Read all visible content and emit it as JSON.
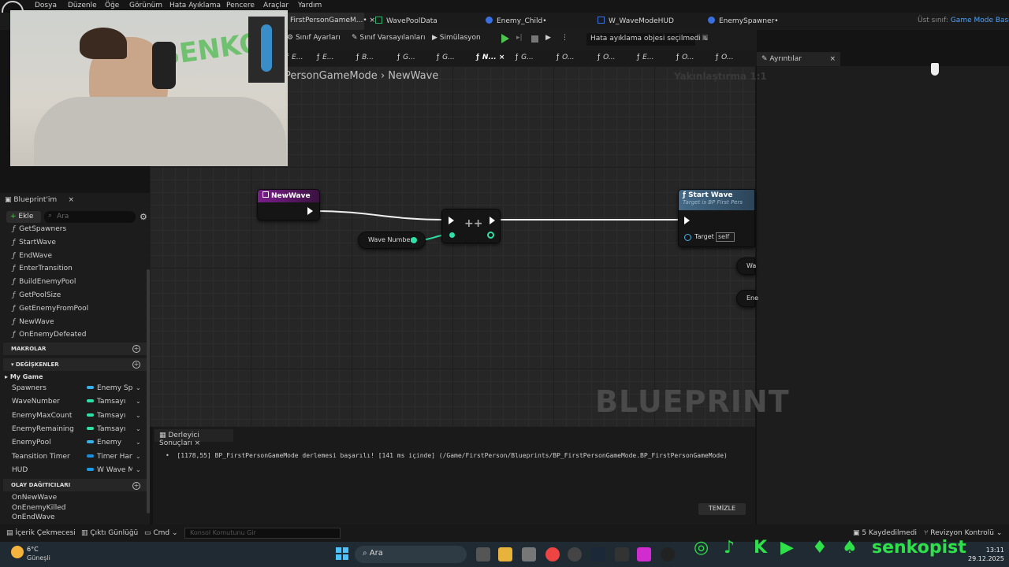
{
  "menu": [
    "Dosya",
    "Düzenle",
    "Öğe",
    "Görünüm",
    "Hata Ayıklama",
    "Pencere",
    "Araçlar",
    "Yardım"
  ],
  "tabs": [
    {
      "label": "FirstPersonGameM...•",
      "close": "×",
      "color": "#2a6fd1"
    },
    {
      "label": "WavePoolData",
      "color": "#2fb36a"
    },
    {
      "label": "Enemy_Child•",
      "color": "#3a6fe0"
    },
    {
      "label": "W_WaveModeHUD",
      "color": "#3a6fe0"
    },
    {
      "label": "EnemySpawner•",
      "color": "#3a6fe0"
    }
  ],
  "parent_class": {
    "label": "Üst sınıf:",
    "value": "Game Mode Base"
  },
  "toolbar": {
    "class_settings": "Sınıf Ayarları",
    "class_defaults": "Sınıf Varsayılanları",
    "simulation": "Simülasyon",
    "debug_dropdown": "Hata ayıklama objesi seçilmedi"
  },
  "func_tabs": [
    "E...",
    "E...",
    "B...",
    "G...",
    "G...",
    "N...",
    "G...",
    "O...",
    "O...",
    "E...",
    "O...",
    "O..."
  ],
  "details": {
    "tab": "Ayrıntılar",
    "close": "×"
  },
  "graph": {
    "breadcrumb_root": "PersonGameMode",
    "breadcrumb_sep": "›",
    "breadcrumb_current": "NewWave",
    "zoom": "Yakınlaştırma 1:1",
    "watermark": "BLUEPRINT",
    "nodes": {
      "event": {
        "title": "NewWave"
      },
      "increment": {
        "symbol": "++"
      },
      "getter": {
        "label": "Wave Number"
      },
      "call": {
        "title": "Start Wave",
        "subtitle": "Target is BP First Pers",
        "pin_label": "Target",
        "pin_value": "self"
      },
      "partial1": {
        "label": "Wa"
      },
      "partial2": {
        "label": "Ene"
      }
    }
  },
  "left_panel": {
    "tab": "Blueprint'im",
    "close": "×",
    "add_button": "Ekle",
    "search_placeholder": "Ara",
    "functions": [
      "GetSpawners",
      "StartWave",
      "EndWave",
      "EnterTransition",
      "BuildEnemyPool",
      "GetPoolSize",
      "GetEnemyFromPool",
      "NewWave",
      "OnEnemyDefeated"
    ],
    "sections": {
      "macros": "MAKROLAR",
      "variables": "DEĞİŞKENLER",
      "dispatchers": "OLAY DAĞITICILARI"
    },
    "category": "My Game",
    "variables": [
      {
        "name": "Spawners",
        "type": "Enemy Spaw",
        "color": "#3ab0e8"
      },
      {
        "name": "WaveNumber",
        "type": "Tamsayı",
        "color": "#2ee0a5"
      },
      {
        "name": "EnemyMaxCount",
        "type": "Tamsayı",
        "color": "#2ee0a5"
      },
      {
        "name": "EnemyRemaining",
        "type": "Tamsayı",
        "color": "#2ee0a5"
      },
      {
        "name": "EnemyPool",
        "type": "Enemy",
        "color": "#3ab0e8"
      },
      {
        "name": "Teansition Timer",
        "type": "Timer Hand",
        "color": "#1a8fe0"
      },
      {
        "name": "HUD",
        "type": "W Wave Mo",
        "color": "#1a9be8"
      }
    ],
    "dispatchers": [
      "OnNewWave",
      "OnEnemyKilled",
      "OnEndWave"
    ]
  },
  "compiler": {
    "tab": "Derleyici Sonuçları",
    "close": "×",
    "message": "[1178,55] BP_FirstPersonGameMode derlemesi başarılı! [141 ms içinde] (/Game/FirstPerson/Blueprints/BP_FirstPersonGameMode.BP_FirstPersonGameMode)",
    "clear": "TEMİZLE"
  },
  "status": {
    "content_drawer": "İçerik Çekmecesi",
    "output_log": "Çıktı Günlüğü",
    "cmd": "Cmd",
    "console_placeholder": "Konsol Komutunu Gir",
    "saved": "5 Kaydedilmedi",
    "revision": "Revizyon Kontrolü"
  },
  "taskbar": {
    "temp": "6°C",
    "weather": "Güneşli",
    "search": "Ara",
    "time": "13:11",
    "date": "29.12.2025"
  },
  "overlay": {
    "brand": "senkopist",
    "webcam_wall_text": "SENKO"
  }
}
